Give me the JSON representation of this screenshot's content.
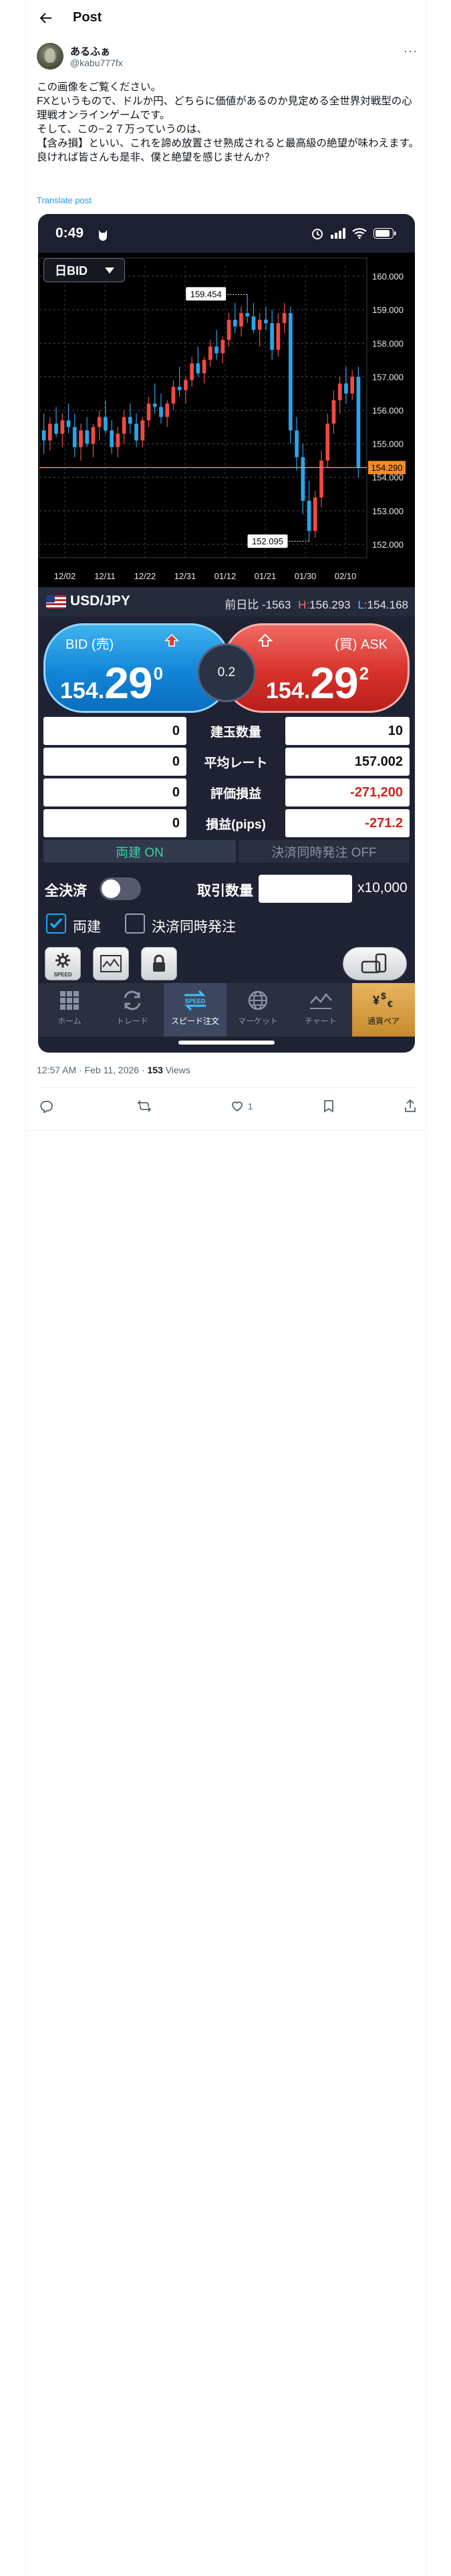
{
  "header": {
    "title": "Post"
  },
  "author": {
    "name": "あるふぁ",
    "handle": "@kabu777fx"
  },
  "tweet": {
    "lines": [
      "この画像をご覧ください。",
      "FXというもので、ドルか円、どちらに価値があるのか見定める全世界対戦型の心理戦オンラインゲームです。",
      "そして、この−２７万っていうのは、",
      "【含み損】といい、これを諦め放置させ熟成されると最高級の絶望が味わえます。",
      "良ければ皆さんも是非、僕と絶望を感じませんか？"
    ],
    "translate_label": "Translate post",
    "time": "12:57 AM · Feb 11, 2026 · ",
    "views_count": "153",
    "views_label": " Views",
    "likes": "1"
  },
  "app": {
    "status_time": "0:49",
    "rate_selector": "日BID",
    "pair": "USD/JPY",
    "change_label": "前日比 -1563",
    "high_label": "H:",
    "high": "156.293",
    "low_label": "L:",
    "low": "154.168",
    "bid": {
      "label": "BID (売)",
      "big_prefix": "154.",
      "big_main": "29",
      "pip": "0"
    },
    "ask": {
      "label": "(買) ASK",
      "big_prefix": "154.",
      "big_main": "29",
      "pip": "2"
    },
    "spread": "0.2",
    "table": [
      {
        "left": "0",
        "label": "建玉数量",
        "right": "10",
        "neg": false
      },
      {
        "left": "0",
        "label": "平均レート",
        "right": "157.002",
        "neg": false
      },
      {
        "left": "0",
        "label": "評価損益",
        "right": "-271,200",
        "neg": true
      },
      {
        "left": "0",
        "label": "損益(pips)",
        "right": "-271.2",
        "neg": true
      }
    ],
    "toggle_on": "両建 ON",
    "toggle_off": "決済同時発注 OFF",
    "settle_all": "全決済",
    "qty_label": "取引数量",
    "qty_value": "",
    "qty_unit": "x10,000",
    "check1": "両建",
    "check2": "決済同時発注",
    "speed_label": "SPEED",
    "nav": [
      "ホーム",
      "トレード",
      "スピード注文",
      "マーケット",
      "チャート",
      "通貨ペア"
    ]
  },
  "chart_data": {
    "type": "candlestick",
    "title": "",
    "x_ticks": [
      "12/02",
      "12/11",
      "12/22",
      "12/31",
      "01/12",
      "01/21",
      "01/30",
      "02/10"
    ],
    "y_ticks": [
      160.0,
      159.0,
      158.0,
      157.0,
      156.0,
      155.0,
      154.0,
      153.0,
      152.0
    ],
    "ylim": [
      151.6,
      160.3
    ],
    "current_price": 154.29,
    "current_label": "154.290",
    "max_marker": {
      "label": "159.454",
      "value": 159.454
    },
    "min_marker": {
      "label": "152.095",
      "value": 152.095
    },
    "colors": {
      "up": "#ef4a42",
      "down": "#2aa4e8",
      "current_line": "#f08a2a"
    },
    "candles": [
      [
        155.4,
        155.9,
        154.7,
        155.1
      ],
      [
        155.1,
        155.8,
        154.8,
        155.6
      ],
      [
        155.6,
        156.1,
        155.2,
        155.3
      ],
      [
        155.3,
        155.9,
        154.9,
        155.7
      ],
      [
        155.7,
        156.2,
        155.3,
        155.5
      ],
      [
        155.5,
        155.9,
        154.6,
        154.9
      ],
      [
        154.9,
        155.6,
        154.5,
        155.4
      ],
      [
        155.4,
        155.8,
        154.9,
        155.0
      ],
      [
        155.0,
        155.6,
        154.6,
        155.5
      ],
      [
        155.5,
        156.0,
        155.1,
        155.8
      ],
      [
        155.8,
        156.3,
        155.3,
        155.4
      ],
      [
        155.4,
        155.7,
        154.7,
        154.9
      ],
      [
        154.9,
        155.5,
        154.6,
        155.3
      ],
      [
        155.3,
        156.0,
        155.0,
        155.8
      ],
      [
        155.8,
        156.2,
        155.3,
        155.6
      ],
      [
        155.6,
        155.9,
        154.9,
        155.1
      ],
      [
        155.1,
        155.8,
        154.9,
        155.7
      ],
      [
        155.7,
        156.4,
        155.5,
        156.2
      ],
      [
        156.2,
        156.8,
        155.9,
        156.1
      ],
      [
        156.1,
        156.5,
        155.6,
        155.8
      ],
      [
        155.8,
        156.3,
        155.5,
        156.2
      ],
      [
        156.2,
        156.9,
        156.0,
        156.7
      ],
      [
        156.7,
        157.3,
        156.4,
        156.6
      ],
      [
        156.6,
        157.0,
        156.2,
        156.9
      ],
      [
        156.9,
        157.6,
        156.7,
        157.4
      ],
      [
        157.4,
        157.9,
        157.0,
        157.1
      ],
      [
        157.1,
        157.6,
        156.8,
        157.5
      ],
      [
        157.5,
        158.1,
        157.3,
        157.9
      ],
      [
        157.9,
        158.4,
        157.5,
        157.7
      ],
      [
        157.7,
        158.2,
        157.4,
        158.1
      ],
      [
        158.1,
        158.9,
        157.9,
        158.7
      ],
      [
        158.7,
        159.2,
        158.3,
        158.5
      ],
      [
        158.5,
        159.1,
        158.2,
        158.9
      ],
      [
        158.9,
        159.45,
        158.6,
        158.8
      ],
      [
        158.8,
        159.2,
        158.3,
        158.4
      ],
      [
        158.4,
        158.9,
        157.9,
        158.7
      ],
      [
        158.7,
        159.1,
        158.4,
        158.6
      ],
      [
        158.6,
        159.0,
        157.5,
        157.8
      ],
      [
        157.8,
        158.9,
        157.6,
        158.6
      ],
      [
        158.6,
        159.2,
        158.3,
        158.9
      ],
      [
        158.9,
        159.1,
        155.0,
        155.4
      ],
      [
        155.4,
        155.8,
        154.2,
        154.6
      ],
      [
        154.6,
        155.0,
        152.9,
        153.3
      ],
      [
        153.3,
        153.9,
        152.1,
        152.4
      ],
      [
        152.4,
        153.6,
        152.2,
        153.4
      ],
      [
        153.4,
        154.8,
        153.1,
        154.5
      ],
      [
        154.5,
        155.9,
        154.3,
        155.6
      ],
      [
        155.6,
        156.6,
        155.3,
        156.3
      ],
      [
        156.3,
        157.0,
        155.9,
        156.8
      ],
      [
        156.8,
        157.3,
        156.2,
        156.5
      ],
      [
        156.5,
        157.2,
        156.3,
        157.0
      ],
      [
        157.0,
        157.3,
        154.0,
        154.29
      ]
    ]
  }
}
